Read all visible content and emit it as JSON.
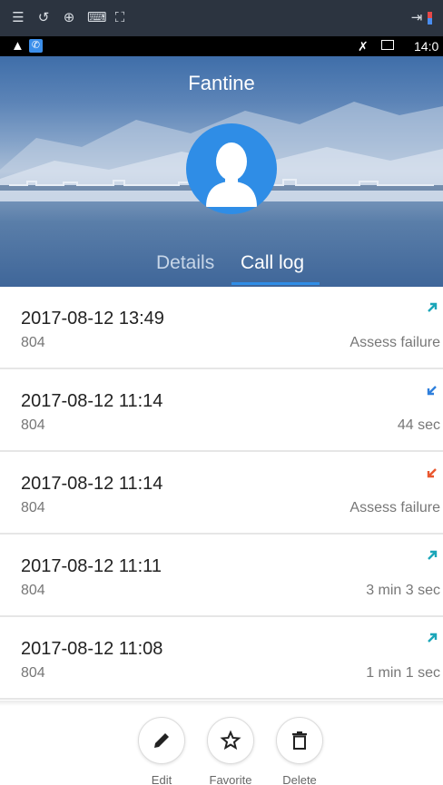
{
  "system_toolbar": {
    "icons": [
      "menu-icon",
      "rotate-icon",
      "zoom-icon",
      "keyboard-icon",
      "fullscreen-icon",
      "exit-icon"
    ]
  },
  "status_bar": {
    "time": "14:0",
    "icons": [
      "warning-icon",
      "phone-app-icon",
      "mute-icon",
      "window-icon"
    ]
  },
  "contact": {
    "name": "Fantine"
  },
  "tabs": [
    {
      "label": "Details",
      "active": false
    },
    {
      "label": "Call log",
      "active": true
    }
  ],
  "call_log": [
    {
      "datetime": "2017-08-12 13:49",
      "number": "804",
      "duration": "Assess failure",
      "type": "outgoing",
      "color": "#1ba6b9"
    },
    {
      "datetime": "2017-08-12 11:14",
      "number": "804",
      "duration": "44 sec",
      "type": "incoming",
      "color": "#2f7fdc"
    },
    {
      "datetime": "2017-08-12 11:14",
      "number": "804",
      "duration": "Assess failure",
      "type": "missed",
      "color": "#e9572f"
    },
    {
      "datetime": "2017-08-12 11:11",
      "number": "804",
      "duration": "3 min 3 sec",
      "type": "outgoing",
      "color": "#1ba6b9"
    },
    {
      "datetime": "2017-08-12 11:08",
      "number": "804",
      "duration": "1 min 1 sec",
      "type": "outgoing",
      "color": "#1ba6b9"
    }
  ],
  "actions": {
    "edit_label": "Edit",
    "favorite_label": "Favorite",
    "delete_label": "Delete"
  },
  "colors": {
    "accent": "#2f8de6",
    "outgoing": "#1ba6b9",
    "incoming": "#2f7fdc",
    "missed": "#e9572f"
  }
}
